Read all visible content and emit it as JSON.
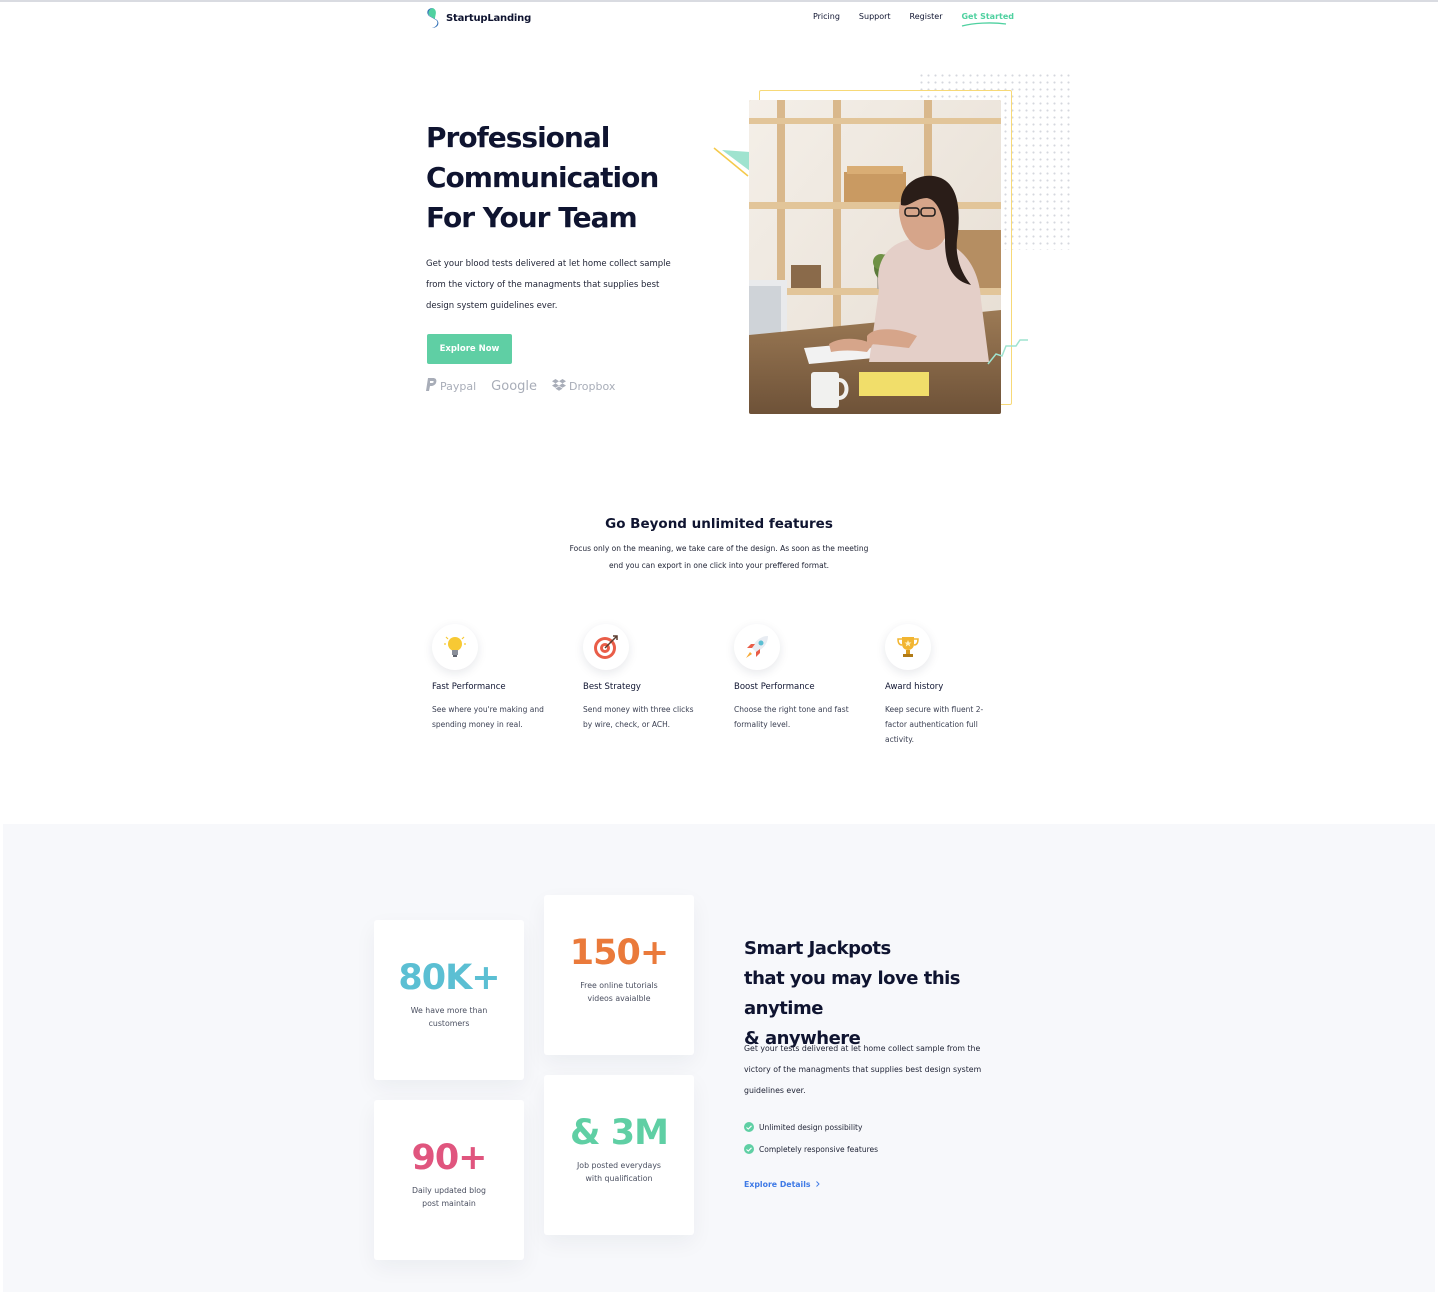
{
  "nav": {
    "brand": "StartupLanding",
    "links": [
      "Pricing",
      "Support",
      "Register"
    ],
    "cta": "Get Started"
  },
  "hero": {
    "title_lines": [
      "Professional",
      "Communication",
      "For Your Team"
    ],
    "description": "Get your blood tests delivered at let home collect sample from the victory of the managments that supplies best design system guidelines ever.",
    "button": "Explore Now",
    "brands": [
      "Paypal",
      "Google",
      "Dropbox"
    ]
  },
  "features": {
    "title": "Go Beyond unlimited features",
    "subtitle": "Focus only on the meaning, we take care of the design. As soon as the meeting end you can export in one click into your preffered format.",
    "items": [
      {
        "icon": "lightbulb-icon",
        "name": "Fast Performance",
        "desc": "See where you're making and spending money in real."
      },
      {
        "icon": "target-icon",
        "name": "Best Strategy",
        "desc": "Send money with three clicks by wire, check, or ACH."
      },
      {
        "icon": "rocket-icon",
        "name": "Boost Performance",
        "desc": "Choose the right tone and fast formality level."
      },
      {
        "icon": "trophy-icon",
        "name": "Award history",
        "desc": "Keep secure with fluent 2-factor authentication full activity."
      }
    ]
  },
  "stats": {
    "cards": [
      {
        "value": "80K+",
        "label": "We have more than customers",
        "color": "#5bbfd3"
      },
      {
        "value": "150+",
        "label": "Free online tutorials videos avaialble",
        "color": "#ea7a3b"
      },
      {
        "value": "90+",
        "label": "Daily updated blog post maintain",
        "color": "#e0557e"
      },
      {
        "value": "& 3M",
        "label": "Job posted everydays with qualification",
        "color": "#5fcfa4"
      }
    ],
    "title_lines": [
      "Smart Jackpots",
      "that you may love this anytime",
      "& anywhere"
    ],
    "description": "Get your tests delivered at let home collect sample from the victory of the managments that supplies best design system guidelines ever.",
    "checks": [
      "Unlimited design possibility",
      "Completely responsive features"
    ],
    "link": "Explore Details"
  },
  "colors": {
    "accent_green": "#5fcfa4",
    "navy": "#0f1430",
    "link_blue": "#3f7ae6"
  }
}
